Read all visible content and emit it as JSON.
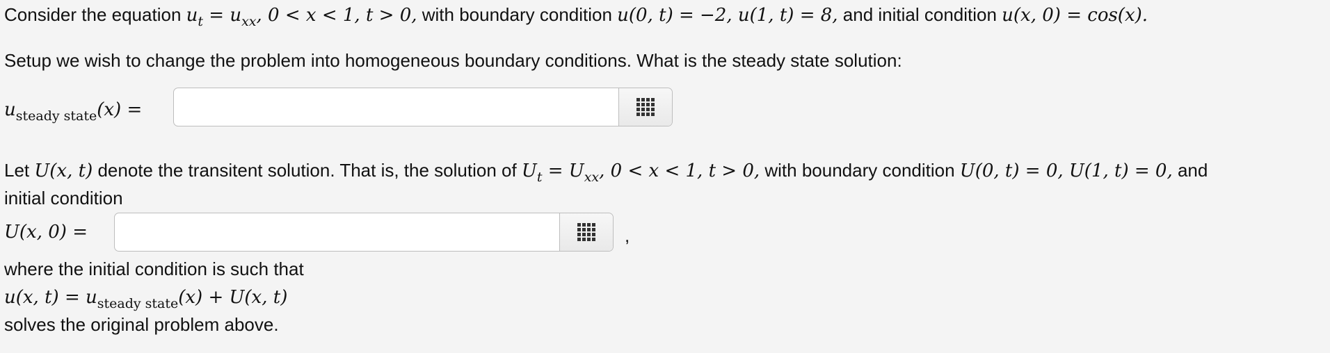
{
  "intro": {
    "text1": "Consider the equation ",
    "eq": "u",
    "eq_sub_t": "t",
    "eq2": " = u",
    "eq_sub_xx": "xx",
    "eq3": ", 0 < x < 1, t > 0,",
    "text2": " with boundary condition ",
    "bc": "u(0, t) = −2, u(1, t) = 8,",
    "text3": " and initial condition ",
    "ic": "u(x, 0) = cos(x)."
  },
  "q1": {
    "prompt": "Setup we wish to change the problem into homogeneous boundary conditions. What is the steady state solution:",
    "label_u": "u",
    "label_sub": "steady state",
    "label_rest": "(x) =",
    "answer_value": ""
  },
  "q2": {
    "text1": "Let ",
    "Uxt": "U(x, t)",
    "text2": " denote the transitent solution. That is, the solution of ",
    "eqU": "U",
    "eqU_sub_t": "t",
    "eqU2": " = U",
    "eqU_sub_xx": "xx",
    "eqU3": ", 0 < x < 1, t > 0,",
    "text3": " with boundary condition ",
    "bcU": "U(0, t) = 0, U(1, t) = 0,",
    "text4": " and",
    "text5": "initial condition",
    "label": "U(x, 0) =",
    "answer_value": "",
    "comma": ","
  },
  "closing": {
    "line1": "where the initial condition is such that",
    "eq_a": "u(x, t) = u",
    "eq_sub": "steady state",
    "eq_b": "(x) + U(x, t)",
    "line3": "solves the original problem above."
  }
}
